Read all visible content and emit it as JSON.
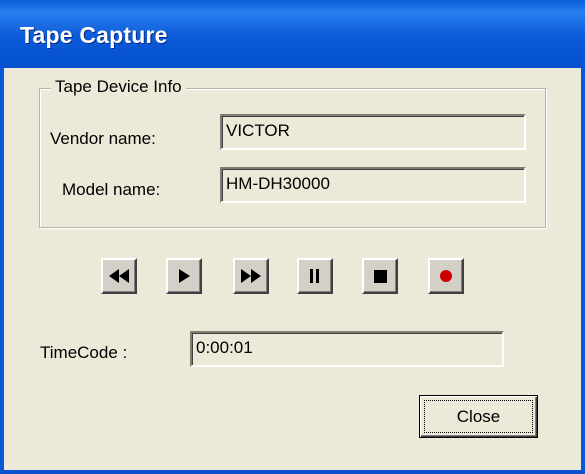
{
  "window": {
    "title": "Tape Capture"
  },
  "device_info": {
    "legend": "Tape Device Info",
    "vendor_label": "Vendor name:",
    "vendor_value": "VICTOR",
    "model_label": "Model name:",
    "model_value": "HM-DH30000"
  },
  "transport": {
    "buttons": [
      {
        "icon": "rewind-icon"
      },
      {
        "icon": "play-icon"
      },
      {
        "icon": "fast-forward-icon"
      },
      {
        "icon": "pause-icon"
      },
      {
        "icon": "stop-icon"
      },
      {
        "icon": "record-icon",
        "color": "#cc0000"
      }
    ]
  },
  "timecode": {
    "label": "TimeCode :",
    "value": "0:00:01"
  },
  "footer": {
    "close_label": "Close"
  }
}
